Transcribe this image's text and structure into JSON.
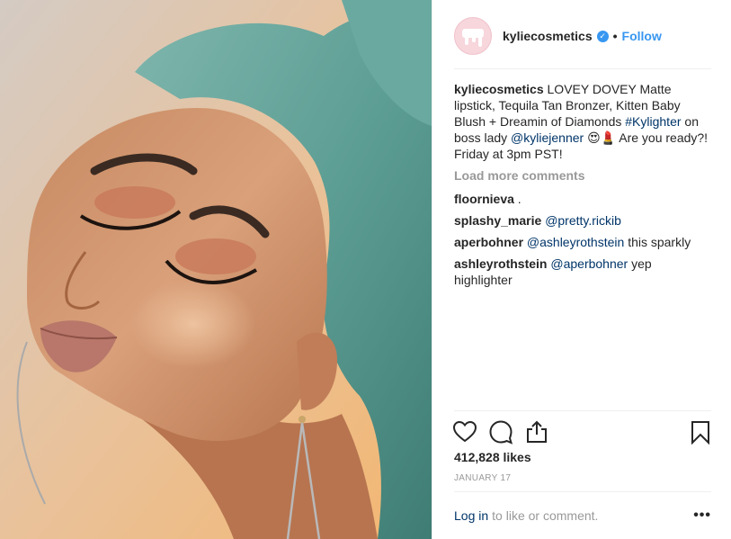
{
  "post": {
    "username": "kyliecosmetics",
    "verified_mark": "✓",
    "separator": "•",
    "follow_label": "Follow",
    "caption": {
      "username": "kyliecosmetics",
      "text_part1": " LOVEY DOVEY Matte lipstick, Tequila Tan Bronzer, Kitten Baby Blush + Dreamin of Diamonds ",
      "hashtag": "#Kylighter",
      "text_part2": " on boss lady ",
      "mention": "@kyliejenner",
      "emojis": " 😍💄 ",
      "text_part3": "Are you ready?! Friday at 3pm PST!"
    },
    "load_more_label": "Load more comments",
    "comments": [
      {
        "username": "floornieva",
        "mention": "",
        "text": "."
      },
      {
        "username": "splashy_marie",
        "mention": "@pretty.rickib",
        "text": ""
      },
      {
        "username": "aperbohner",
        "mention": "@ashleyrothstein",
        "text": "this sparkly"
      },
      {
        "username": "ashleyrothstein",
        "mention": "@aperbohner",
        "text": "yep highlighter"
      }
    ],
    "likes": "412,828 likes",
    "date": "JANUARY 17",
    "footer": {
      "login_label": "Log in",
      "login_suffix": "to like or comment.",
      "more_label": "•••"
    }
  },
  "icons": [
    "heart-icon",
    "comment-icon",
    "share-icon",
    "bookmark-icon",
    "verified-icon"
  ],
  "colors": {
    "accent": "#3897f0",
    "link": "#003569",
    "muted": "#999999",
    "text": "#262626",
    "hair": "#5d9e94"
  }
}
